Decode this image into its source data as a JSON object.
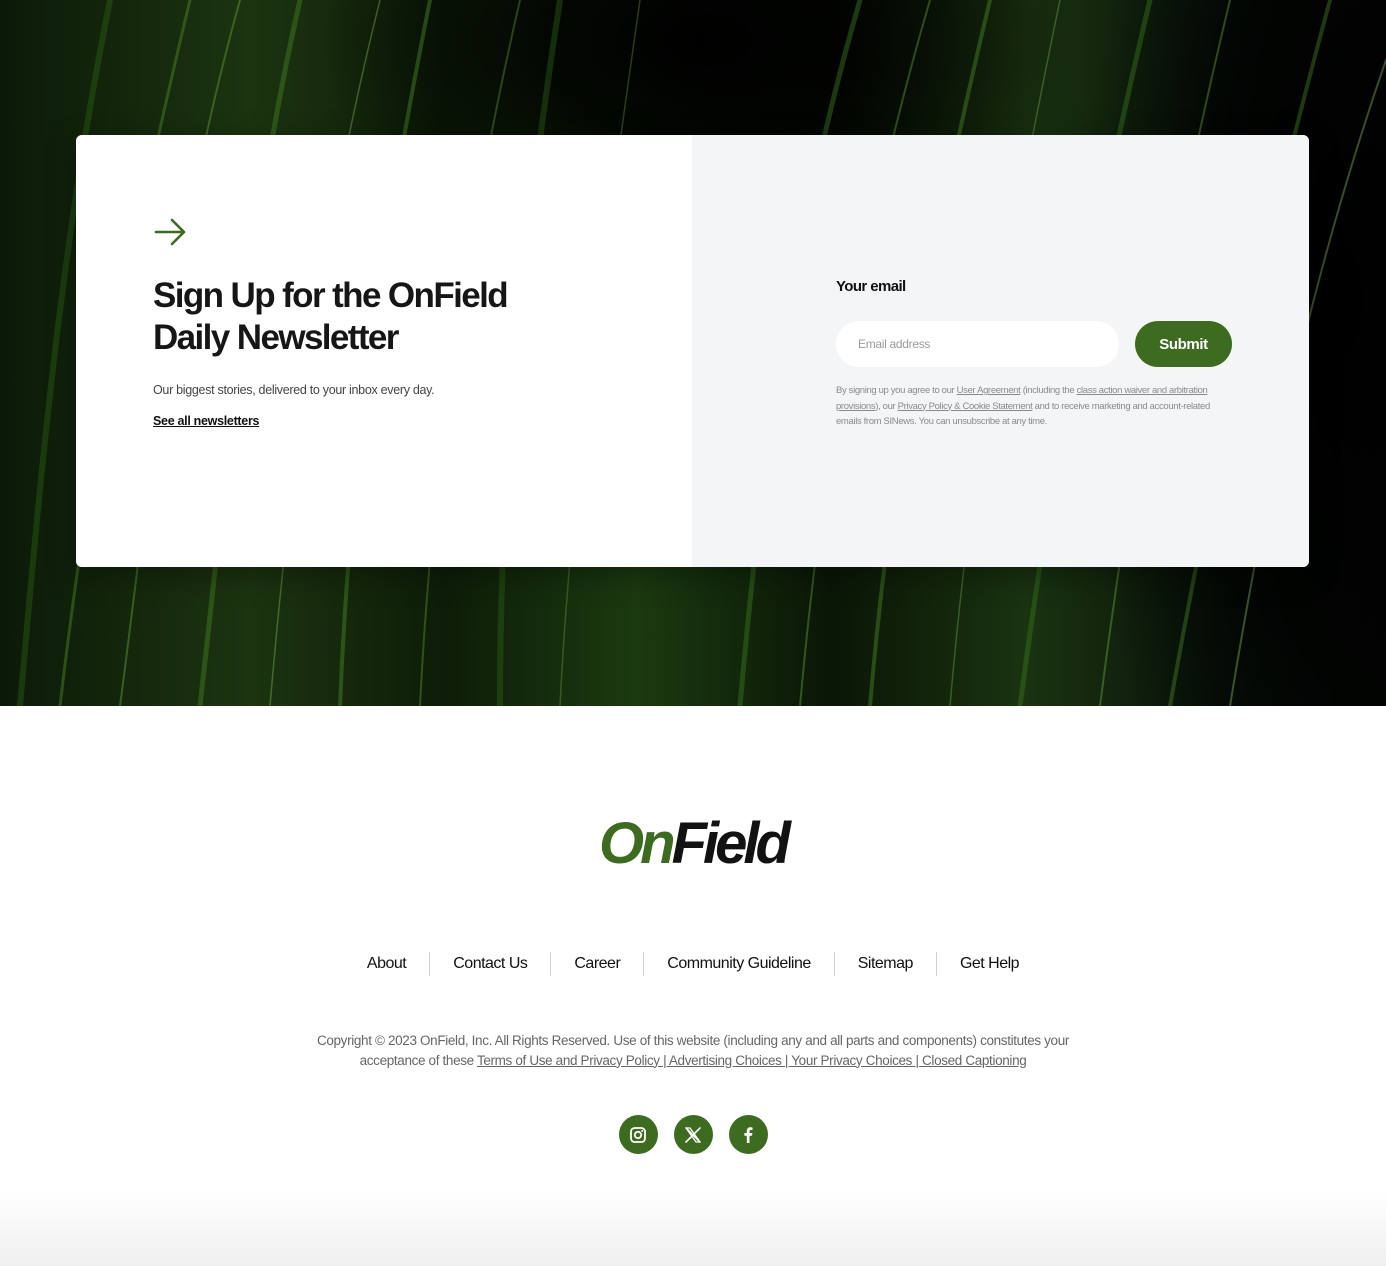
{
  "colors": {
    "brand_green": "#3d6b1f",
    "card_right_bg": "#f4f5f7"
  },
  "newsletter": {
    "headline": "Sign Up for the OnField Daily Newsletter",
    "subtext": "Our biggest stories, delivered to your inbox every day.",
    "all_link": "See all newsletters",
    "email_label": "Your email",
    "email_placeholder": "Email address",
    "email_value": "",
    "submit_label": "Submit",
    "legal": {
      "t1": "By signing up you agree to our ",
      "link1": "User Agreement",
      "t2": " (including the ",
      "link2": "class action waiver and arbitration provisions",
      "t3": "), our ",
      "link3": "Privacy Policy & Cookie Statement",
      "t4": " and to receive marketing and account-related emails from SINews. You can unsubscribe at any time."
    }
  },
  "footer": {
    "logo": {
      "part1": "On",
      "part2": "Field"
    },
    "nav": [
      "About",
      "Contact Us",
      "Career",
      "Community Guideline",
      "Sitemap",
      "Get Help"
    ],
    "copyright_text": "Copyright © 2023 OnField, Inc. All Rights Reserved. Use of this website (including any and all parts and components) constitutes your acceptance of these ",
    "copyright_link": "Terms of Use and Privacy Policy | Advertising Choices | Your Privacy Choices | Closed Captioning",
    "social": [
      {
        "icon": "instagram-icon"
      },
      {
        "icon": "x-icon"
      },
      {
        "icon": "facebook-icon"
      }
    ]
  }
}
